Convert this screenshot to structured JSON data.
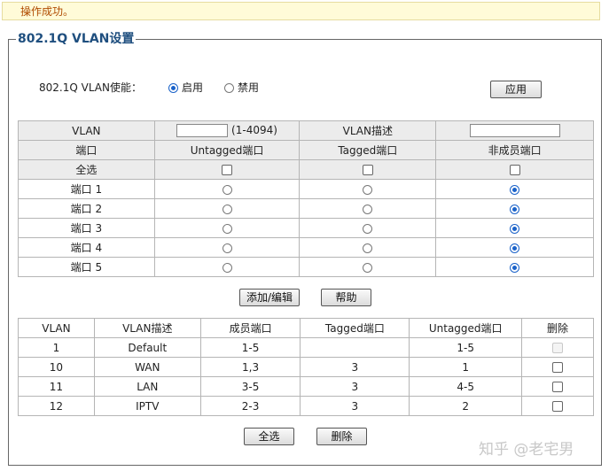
{
  "notice": "操作成功。",
  "section_title": "802.1Q VLAN设置",
  "enable": {
    "label": "802.1Q VLAN使能：",
    "opt_on": "启用",
    "opt_off": "禁用",
    "selected": "启用"
  },
  "apply_label": "应用",
  "form": {
    "vlan_label": "VLAN",
    "vlan_range": "(1-4094)",
    "vlan_value": "",
    "desc_label": "VLAN描述",
    "desc_value": "",
    "header": {
      "port": "端口",
      "untagged": "Untagged端口",
      "tagged": "Tagged端口",
      "non_member": "非成员端口"
    },
    "select_all": "全选",
    "ports": [
      {
        "name": "端口 1",
        "selected": "non_member"
      },
      {
        "name": "端口 2",
        "selected": "non_member"
      },
      {
        "name": "端口 3",
        "selected": "non_member"
      },
      {
        "name": "端口 4",
        "selected": "non_member"
      },
      {
        "name": "端口 5",
        "selected": "non_member"
      }
    ]
  },
  "add_edit_label": "添加/编辑",
  "help_label": "帮助",
  "list": {
    "headers": [
      "VLAN",
      "VLAN描述",
      "成员端口",
      "Tagged端口",
      "Untagged端口",
      "删除"
    ],
    "rows": [
      {
        "vlan": "1",
        "desc": "Default",
        "members": "1-5",
        "tagged": "",
        "untagged": "1-5",
        "deletable": false
      },
      {
        "vlan": "10",
        "desc": "WAN",
        "members": "1,3",
        "tagged": "3",
        "untagged": "1",
        "deletable": true
      },
      {
        "vlan": "11",
        "desc": "LAN",
        "members": "3-5",
        "tagged": "3",
        "untagged": "4-5",
        "deletable": true
      },
      {
        "vlan": "12",
        "desc": "IPTV",
        "members": "2-3",
        "tagged": "3",
        "untagged": "2",
        "deletable": true
      }
    ]
  },
  "select_all_label": "全选",
  "delete_label": "删除",
  "watermark": "知乎 @老宅男"
}
